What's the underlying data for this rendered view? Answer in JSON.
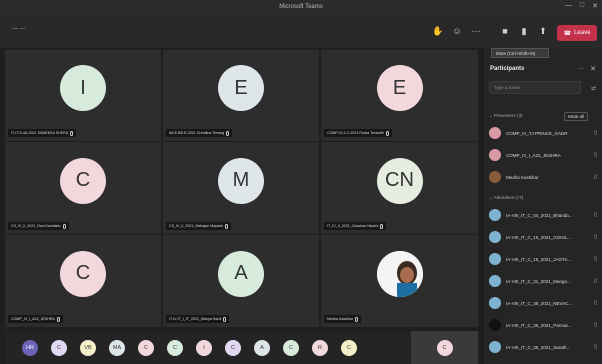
{
  "window": {
    "title": "Microsoft Teams",
    "controls": [
      "—",
      "□",
      "✕"
    ]
  },
  "toolbar": {
    "timer": "— —",
    "leave_label": "Leave",
    "buttons": [
      {
        "name": "raise-hand-icon",
        "glyph": "✋"
      },
      {
        "name": "reactions-icon",
        "glyph": "☺"
      },
      {
        "name": "more-icon",
        "glyph": "···"
      },
      {
        "name": "camera-icon",
        "glyph": "■"
      },
      {
        "name": "mic-icon",
        "glyph": "▮"
      },
      {
        "name": "share-icon",
        "glyph": "⬆"
      }
    ]
  },
  "tooltip": "Mute (Ctrl+Shift+M)",
  "tiles": [
    {
      "initials": "I",
      "color": "#d6ebdc",
      "name": "IT-IT-S-4A-2021 SAMEEKA SHERA"
    },
    {
      "initials": "E",
      "color": "#dfe6ea",
      "name": "MCE-BE-E-2021 Greatlina Timang"
    },
    {
      "initials": "E",
      "color": "#f2d8dc",
      "name": "COMP-IV-1-C-2021 Rudra Tresmith"
    },
    {
      "initials": "C",
      "color": "#f2d8dc",
      "name": "CS_IV_II_2021_Ravi Kashiabh"
    },
    {
      "initials": "M",
      "color": "#dfe6ea",
      "name": "CS_IV_II_2021_Mahajan Mayank"
    },
    {
      "initials": "CN",
      "color": "#e6ecdf",
      "name": "IT_IV_II_2021_Chauhan Nivarhi"
    },
    {
      "initials": "C",
      "color": "#f2d8dc",
      "name": "COMP_IV_I_A22_JESHRA"
    },
    {
      "initials": "A",
      "color": "#d6ebdc",
      "name": "IT-IV-IT_I_IT_2021_Manya Hardi"
    },
    {
      "initials": "",
      "color": "#ffffff",
      "name": "Medha Kashikar",
      "photo": true
    }
  ],
  "strip": [
    {
      "initials": "HR",
      "color": "#6c63b8"
    },
    {
      "initials": "C",
      "color": "#e1d9f2"
    },
    {
      "initials": "VB",
      "color": "#f5efc8"
    },
    {
      "initials": "MA",
      "color": "#dfe6ea"
    },
    {
      "initials": "C",
      "color": "#f2d8dc"
    },
    {
      "initials": "C",
      "color": "#d6ebdc"
    },
    {
      "initials": "I",
      "color": "#f2d8dc"
    },
    {
      "initials": "C",
      "color": "#e1d9f2"
    },
    {
      "initials": "A",
      "color": "#dfe6ea"
    },
    {
      "initials": "C",
      "color": "#d6ebdc"
    },
    {
      "initials": "R",
      "color": "#f2d8dc"
    },
    {
      "initials": "C",
      "color": "#f5efc8"
    }
  ],
  "strip_last": {
    "initials": "C",
    "color": "#f2d8dc"
  },
  "panel": {
    "title": "Participants",
    "search_placeholder": "Type a name",
    "presenters_label": "Presenters (3)",
    "mute_all": "Mute all",
    "attendees_label": "Attendees (17)",
    "presenters": [
      {
        "name": "COMP_IV_TJ PRINCE_GADR",
        "color": "#d99aa6"
      },
      {
        "name": "COMP_IV_I_A22_JESHRA",
        "color": "#d99aa6"
      },
      {
        "name": "Medha Kashikar",
        "color": "#8a5a3c"
      }
    ],
    "attendees": [
      {
        "name": "IA-VIII_IT_C_04_2021_Bhanda...",
        "color": "#7fb2d1"
      },
      {
        "name": "IA-VIII_IT_C_16_2021_GOHIL...",
        "color": "#7fb2d1"
      },
      {
        "name": "IA-VIII_IT_C_16_2021_JAGTA...",
        "color": "#7fb2d1"
      },
      {
        "name": "IA-VIII_IT_C_31_2021_Mango...",
        "color": "#7fb2d1"
      },
      {
        "name": "IA-VIII_IT_C_36_2021_NEVAC...",
        "color": "#7fb2d1"
      },
      {
        "name": "IA-VIII_IT_C_36_2021_Parmar...",
        "color": "#111111"
      },
      {
        "name": "IA-VIII_IT_C_36_2021_Sarath...",
        "color": "#7fb2d1"
      }
    ]
  }
}
